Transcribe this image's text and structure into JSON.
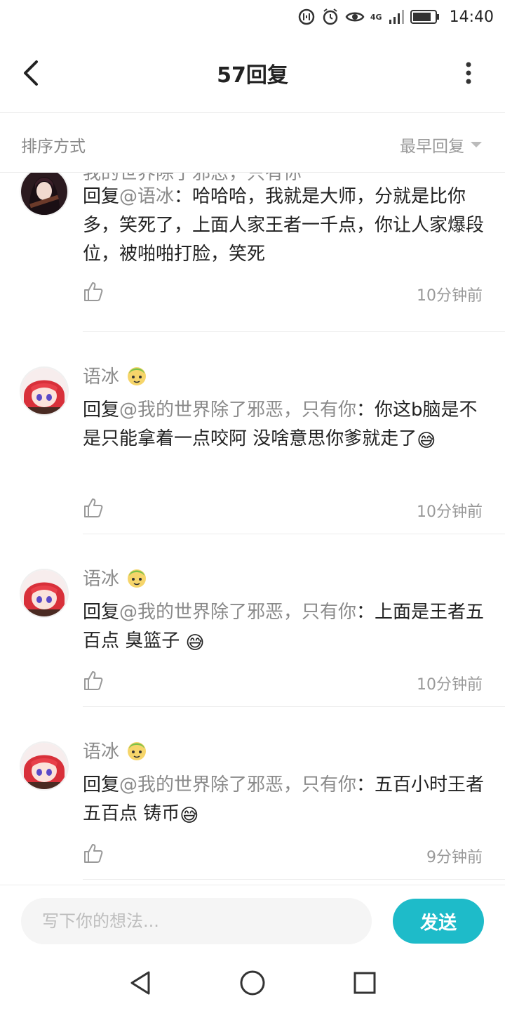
{
  "status_bar": {
    "time": "14:40",
    "network": "4G"
  },
  "header": {
    "title": "57回复"
  },
  "sort": {
    "label": "排序方式",
    "value": "最早回复"
  },
  "comments": [
    {
      "username": "我的世界除了邪恶，只有你",
      "reply_prefix": "回复",
      "mention": "@语冰",
      "separator": "：",
      "text": "哈哈哈，我就是大师，分就是比你多，笑死了，上面人家王者一千点，你让人家爆段位，被啪啪打脸，笑死",
      "emoji": "",
      "time": "10分钟前"
    },
    {
      "username": "语冰",
      "reply_prefix": "回复",
      "mention": "@我的世界除了邪恶，只有你",
      "separator": "：",
      "text": "你这b脑是不是只能拿着一点咬阿 没啥意思你爹就走了",
      "emoji": "😅",
      "time": "10分钟前"
    },
    {
      "username": "语冰",
      "reply_prefix": "回复",
      "mention": "@我的世界除了邪恶，只有你",
      "separator": "：",
      "text": "上面是王者五百点 臭篮子",
      "emoji": "😅",
      "time": "10分钟前"
    },
    {
      "username": "语冰",
      "reply_prefix": "回复",
      "mention": "@我的世界除了邪恶，只有你",
      "separator": "：",
      "text": "五百小时王者五百点 铸币",
      "emoji": "😅",
      "time": "9分钟前"
    }
  ],
  "composer": {
    "placeholder": "写下你的想法...",
    "send_label": "发送"
  },
  "colors": {
    "accent": "#1ebbc9",
    "muted": "#8a8a8a"
  }
}
